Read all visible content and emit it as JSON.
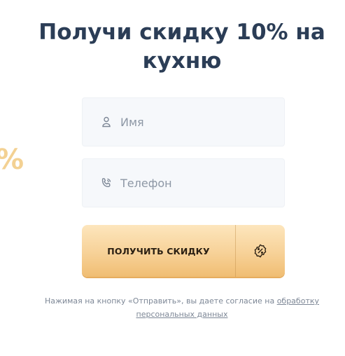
{
  "title": "Получи скидку 10% на кухню",
  "deco_glyph": "%",
  "form": {
    "name_placeholder": "Имя",
    "phone_placeholder": "Телефон",
    "submit_label": "ПОЛУЧИТЬ СКИДКУ",
    "name_icon": "user-icon",
    "phone_icon": "phone-icon",
    "submit_icon": "discount-badge-icon"
  },
  "consent": {
    "text": "Нажимая на кнопку «Отправить», вы даете согласие на ",
    "link": "обработку персональных данных"
  },
  "colors": {
    "title": "#2b3d56",
    "button_top": "#fde6bd",
    "button_bottom": "#f0bd72",
    "field_bg": "#f6f8fb",
    "muted_text": "#7d8796",
    "accent": "#f1c981"
  }
}
